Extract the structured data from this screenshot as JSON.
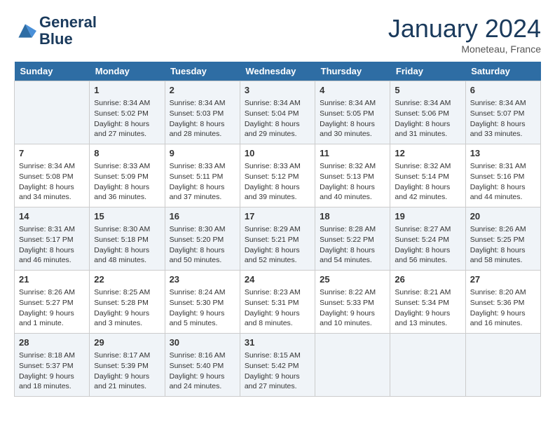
{
  "header": {
    "logo_line1": "General",
    "logo_line2": "Blue",
    "month_title": "January 2024",
    "location": "Moneteau, France"
  },
  "days_of_week": [
    "Sunday",
    "Monday",
    "Tuesday",
    "Wednesday",
    "Thursday",
    "Friday",
    "Saturday"
  ],
  "weeks": [
    [
      {
        "day": "",
        "sunrise": "",
        "sunset": "",
        "daylight": ""
      },
      {
        "day": "1",
        "sunrise": "Sunrise: 8:34 AM",
        "sunset": "Sunset: 5:02 PM",
        "daylight": "Daylight: 8 hours and 27 minutes."
      },
      {
        "day": "2",
        "sunrise": "Sunrise: 8:34 AM",
        "sunset": "Sunset: 5:03 PM",
        "daylight": "Daylight: 8 hours and 28 minutes."
      },
      {
        "day": "3",
        "sunrise": "Sunrise: 8:34 AM",
        "sunset": "Sunset: 5:04 PM",
        "daylight": "Daylight: 8 hours and 29 minutes."
      },
      {
        "day": "4",
        "sunrise": "Sunrise: 8:34 AM",
        "sunset": "Sunset: 5:05 PM",
        "daylight": "Daylight: 8 hours and 30 minutes."
      },
      {
        "day": "5",
        "sunrise": "Sunrise: 8:34 AM",
        "sunset": "Sunset: 5:06 PM",
        "daylight": "Daylight: 8 hours and 31 minutes."
      },
      {
        "day": "6",
        "sunrise": "Sunrise: 8:34 AM",
        "sunset": "Sunset: 5:07 PM",
        "daylight": "Daylight: 8 hours and 33 minutes."
      }
    ],
    [
      {
        "day": "7",
        "sunrise": "Sunrise: 8:34 AM",
        "sunset": "Sunset: 5:08 PM",
        "daylight": "Daylight: 8 hours and 34 minutes."
      },
      {
        "day": "8",
        "sunrise": "Sunrise: 8:33 AM",
        "sunset": "Sunset: 5:09 PM",
        "daylight": "Daylight: 8 hours and 36 minutes."
      },
      {
        "day": "9",
        "sunrise": "Sunrise: 8:33 AM",
        "sunset": "Sunset: 5:11 PM",
        "daylight": "Daylight: 8 hours and 37 minutes."
      },
      {
        "day": "10",
        "sunrise": "Sunrise: 8:33 AM",
        "sunset": "Sunset: 5:12 PM",
        "daylight": "Daylight: 8 hours and 39 minutes."
      },
      {
        "day": "11",
        "sunrise": "Sunrise: 8:32 AM",
        "sunset": "Sunset: 5:13 PM",
        "daylight": "Daylight: 8 hours and 40 minutes."
      },
      {
        "day": "12",
        "sunrise": "Sunrise: 8:32 AM",
        "sunset": "Sunset: 5:14 PM",
        "daylight": "Daylight: 8 hours and 42 minutes."
      },
      {
        "day": "13",
        "sunrise": "Sunrise: 8:31 AM",
        "sunset": "Sunset: 5:16 PM",
        "daylight": "Daylight: 8 hours and 44 minutes."
      }
    ],
    [
      {
        "day": "14",
        "sunrise": "Sunrise: 8:31 AM",
        "sunset": "Sunset: 5:17 PM",
        "daylight": "Daylight: 8 hours and 46 minutes."
      },
      {
        "day": "15",
        "sunrise": "Sunrise: 8:30 AM",
        "sunset": "Sunset: 5:18 PM",
        "daylight": "Daylight: 8 hours and 48 minutes."
      },
      {
        "day": "16",
        "sunrise": "Sunrise: 8:30 AM",
        "sunset": "Sunset: 5:20 PM",
        "daylight": "Daylight: 8 hours and 50 minutes."
      },
      {
        "day": "17",
        "sunrise": "Sunrise: 8:29 AM",
        "sunset": "Sunset: 5:21 PM",
        "daylight": "Daylight: 8 hours and 52 minutes."
      },
      {
        "day": "18",
        "sunrise": "Sunrise: 8:28 AM",
        "sunset": "Sunset: 5:22 PM",
        "daylight": "Daylight: 8 hours and 54 minutes."
      },
      {
        "day": "19",
        "sunrise": "Sunrise: 8:27 AM",
        "sunset": "Sunset: 5:24 PM",
        "daylight": "Daylight: 8 hours and 56 minutes."
      },
      {
        "day": "20",
        "sunrise": "Sunrise: 8:26 AM",
        "sunset": "Sunset: 5:25 PM",
        "daylight": "Daylight: 8 hours and 58 minutes."
      }
    ],
    [
      {
        "day": "21",
        "sunrise": "Sunrise: 8:26 AM",
        "sunset": "Sunset: 5:27 PM",
        "daylight": "Daylight: 9 hours and 1 minute."
      },
      {
        "day": "22",
        "sunrise": "Sunrise: 8:25 AM",
        "sunset": "Sunset: 5:28 PM",
        "daylight": "Daylight: 9 hours and 3 minutes."
      },
      {
        "day": "23",
        "sunrise": "Sunrise: 8:24 AM",
        "sunset": "Sunset: 5:30 PM",
        "daylight": "Daylight: 9 hours and 5 minutes."
      },
      {
        "day": "24",
        "sunrise": "Sunrise: 8:23 AM",
        "sunset": "Sunset: 5:31 PM",
        "daylight": "Daylight: 9 hours and 8 minutes."
      },
      {
        "day": "25",
        "sunrise": "Sunrise: 8:22 AM",
        "sunset": "Sunset: 5:33 PM",
        "daylight": "Daylight: 9 hours and 10 minutes."
      },
      {
        "day": "26",
        "sunrise": "Sunrise: 8:21 AM",
        "sunset": "Sunset: 5:34 PM",
        "daylight": "Daylight: 9 hours and 13 minutes."
      },
      {
        "day": "27",
        "sunrise": "Sunrise: 8:20 AM",
        "sunset": "Sunset: 5:36 PM",
        "daylight": "Daylight: 9 hours and 16 minutes."
      }
    ],
    [
      {
        "day": "28",
        "sunrise": "Sunrise: 8:18 AM",
        "sunset": "Sunset: 5:37 PM",
        "daylight": "Daylight: 9 hours and 18 minutes."
      },
      {
        "day": "29",
        "sunrise": "Sunrise: 8:17 AM",
        "sunset": "Sunset: 5:39 PM",
        "daylight": "Daylight: 9 hours and 21 minutes."
      },
      {
        "day": "30",
        "sunrise": "Sunrise: 8:16 AM",
        "sunset": "Sunset: 5:40 PM",
        "daylight": "Daylight: 9 hours and 24 minutes."
      },
      {
        "day": "31",
        "sunrise": "Sunrise: 8:15 AM",
        "sunset": "Sunset: 5:42 PM",
        "daylight": "Daylight: 9 hours and 27 minutes."
      },
      {
        "day": "",
        "sunrise": "",
        "sunset": "",
        "daylight": ""
      },
      {
        "day": "",
        "sunrise": "",
        "sunset": "",
        "daylight": ""
      },
      {
        "day": "",
        "sunrise": "",
        "sunset": "",
        "daylight": ""
      }
    ]
  ]
}
